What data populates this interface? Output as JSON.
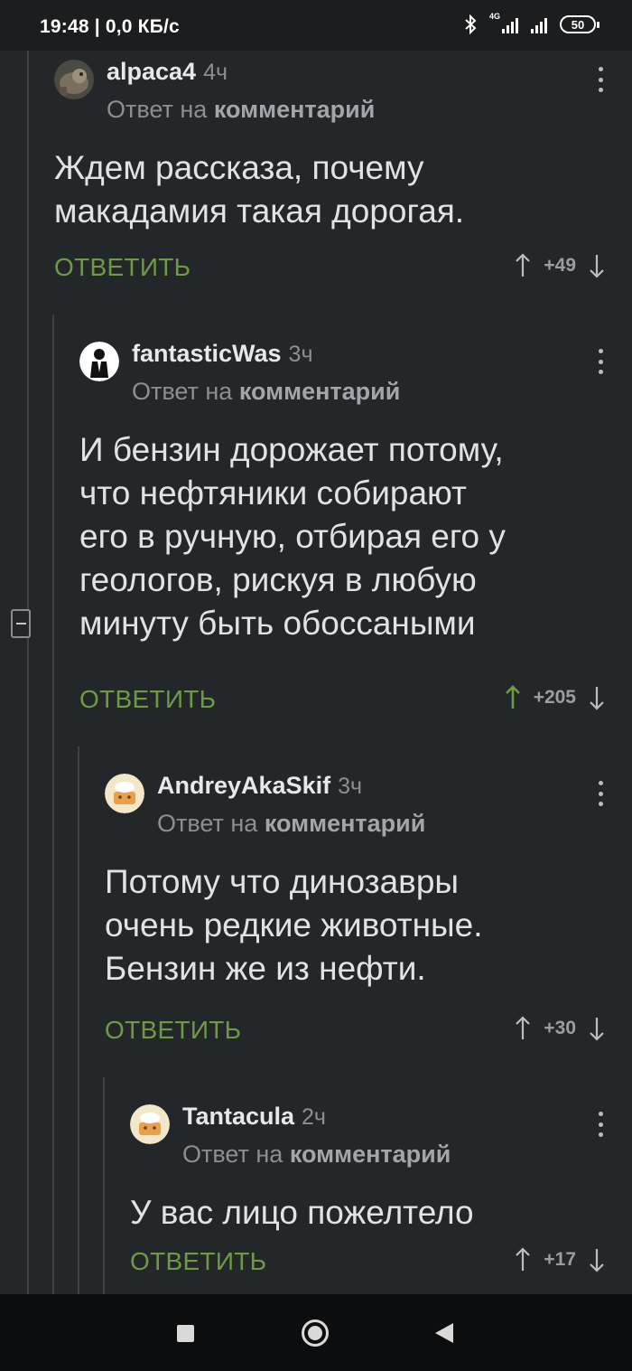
{
  "status_bar": {
    "time_speed": "19:48 | 0,0 КБ/с",
    "network": "4G",
    "battery": "50"
  },
  "comments": [
    {
      "username": "alpaca4",
      "time": "4ч",
      "reply_prefix": "Ответ на",
      "reply_target": "комментарий",
      "text": "Ждем рассказа, почему\nмакадамия такая дорогая.",
      "reply_label": "ОТВЕТИТЬ",
      "score": "+49",
      "upvoted": false
    },
    {
      "username": "fantasticWas",
      "time": "3ч",
      "reply_prefix": "Ответ на",
      "reply_target": "комментарий",
      "text": "И бензин дорожает потому,\nчто нефтяники собирают\nего в ручную, отбирая его у\nгеологов, рискуя в любую\nминуту быть обоссаными",
      "reply_label": "ОТВЕТИТЬ",
      "score": "+205",
      "upvoted": true
    },
    {
      "username": "AndreyAkaSkif",
      "time": "3ч",
      "reply_prefix": "Ответ на",
      "reply_target": "комментарий",
      "text": "Потому что динозавры\nочень редкие животные.\nБензин же из нефти.",
      "reply_label": "ОТВЕТИТЬ",
      "score": "+30",
      "upvoted": false
    },
    {
      "username": "Tantacula",
      "time": "2ч",
      "reply_prefix": "Ответ на",
      "reply_target": "комментарий",
      "text": "У вас лицо пожелтело",
      "reply_label": "ОТВЕТИТЬ",
      "score": "+17",
      "upvoted": false
    }
  ],
  "colors": {
    "background": "#24272a",
    "reply_green": "#6f9a45",
    "upvote_active": "#6f9a45",
    "muted": "#8b8f93"
  }
}
